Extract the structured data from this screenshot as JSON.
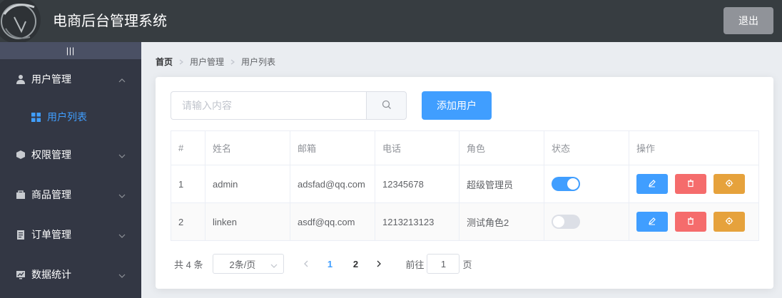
{
  "header": {
    "title": "电商后台管理系统",
    "logout_label": "退出"
  },
  "aside": {
    "toggle_label": "|||",
    "menus": [
      {
        "label": "用户管理",
        "icon": "user-icon",
        "expanded": true
      },
      {
        "label": "权限管理",
        "icon": "box-icon",
        "expanded": false
      },
      {
        "label": "商品管理",
        "icon": "bag-icon",
        "expanded": false
      },
      {
        "label": "订单管理",
        "icon": "document-icon",
        "expanded": false
      },
      {
        "label": "数据统计",
        "icon": "chart-icon",
        "expanded": false
      }
    ],
    "submenu": {
      "label": "用户列表",
      "icon": "grid-icon"
    }
  },
  "breadcrumb": {
    "home": "首页",
    "level1": "用户管理",
    "level2": "用户列表"
  },
  "toolbar": {
    "search_placeholder": "请输入内容",
    "search_value": "",
    "add_label": "添加用户"
  },
  "table": {
    "columns": [
      "#",
      "姓名",
      "邮箱",
      "电话",
      "角色",
      "状态",
      "操作"
    ],
    "rows": [
      {
        "index": "1",
        "name": "admin",
        "email": "adsfad@qq.com",
        "phone": "12345678",
        "role": "超级管理员",
        "status": true
      },
      {
        "index": "2",
        "name": "linken",
        "email": "asdf@qq.com",
        "phone": "1213213123",
        "role": "测试角色2",
        "status": false
      }
    ]
  },
  "pagination": {
    "total": "共 4 条",
    "page_size": "2条/页",
    "pages": [
      "1",
      "2"
    ],
    "current_page": "1",
    "jump_prefix": "前往",
    "jump_value": "1",
    "jump_suffix": "页"
  },
  "colors": {
    "primary": "#409eff",
    "danger": "#f56c6c",
    "warning": "#e6a23c",
    "header_bg": "#373d41",
    "aside_bg": "#333744",
    "main_bg": "#eaedf1"
  }
}
